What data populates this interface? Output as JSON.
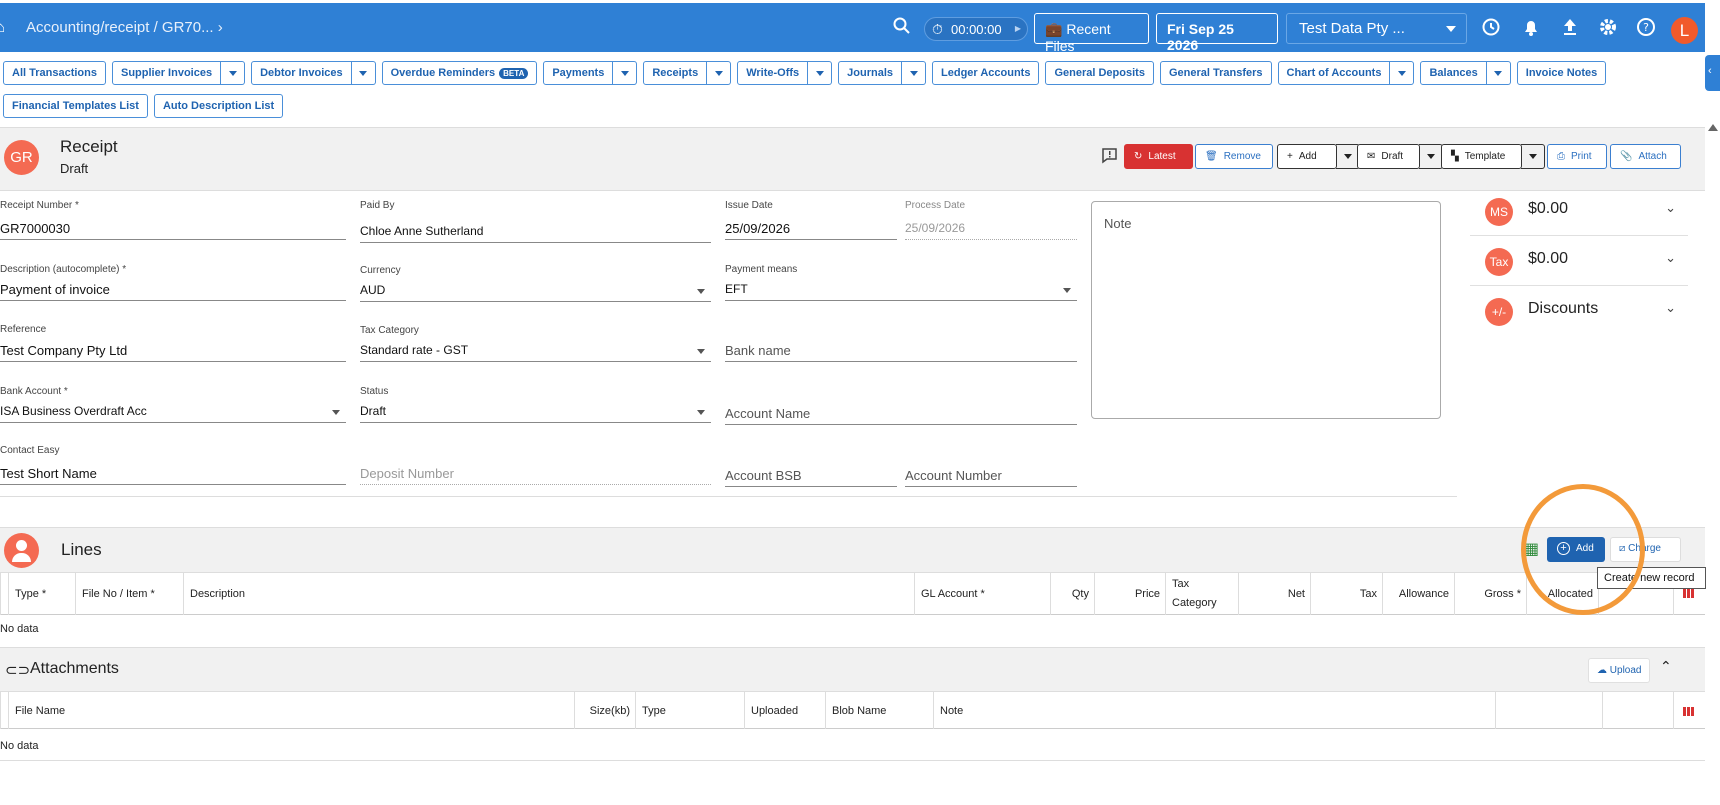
{
  "header": {
    "breadcrumb": "Accounting/receipt / GR70... ›",
    "timer": "00:00:00",
    "recent_files": "Recent Files",
    "date": "Fri Sep 25 2026",
    "company": "Test Data Pty ...",
    "avatar_letter": "L"
  },
  "nav": {
    "row1": [
      "All Transactions",
      "Supplier Invoices",
      "Debtor Invoices",
      "Overdue Reminders",
      "Payments",
      "Receipts",
      "Write-Offs",
      "Journals",
      "Ledger Accounts",
      "General Deposits",
      "General Transfers",
      "Chart of Accounts",
      "Balances",
      "Invoice Notes"
    ],
    "beta": "BETA",
    "row2": [
      "Financial Templates List",
      "Auto Description List"
    ]
  },
  "record": {
    "initials": "GR",
    "title": "Receipt",
    "status": "Draft",
    "actions": {
      "latest": "Latest",
      "remove": "Remove",
      "add": "Add",
      "draft": "Draft",
      "template": "Template",
      "print": "Print",
      "attach": "Attach"
    }
  },
  "form": {
    "receipt_number_label": "Receipt Number *",
    "receipt_number": "GR7000030",
    "paid_by_label": "Paid By",
    "paid_by": "Chloe Anne Sutherland",
    "issue_date_label": "Issue Date",
    "issue_date": "25/09/2026",
    "process_date_label": "Process Date",
    "process_date": "25/09/2026",
    "description_label": "Description (autocomplete) *",
    "description": "Payment of invoice",
    "currency_label": "Currency",
    "currency": "AUD",
    "payment_means_label": "Payment means",
    "payment_means": "EFT",
    "reference_label": "Reference",
    "reference": "Test Company Pty Ltd",
    "tax_category_label": "Tax Category",
    "tax_category": "Standard rate - GST",
    "bank_name_placeholder": "Bank name",
    "bank_account_label": "Bank Account *",
    "bank_account": "ISA Business Overdraft Acc",
    "status_label": "Status",
    "status": "Draft",
    "account_name_placeholder": "Account Name",
    "contact_label": "Contact Easy",
    "contact": "Test Short Name",
    "deposit_number_placeholder": "Deposit Number",
    "account_bsb_placeholder": "Account BSB",
    "account_number_placeholder": "Account Number",
    "note_placeholder": "Note"
  },
  "summary": {
    "ms_badge": "MS",
    "ms_value": "$0.00",
    "tax_badge": "Tax",
    "tax_value": "$0.00",
    "disc_badge": "+/-",
    "disc_label": "Discounts"
  },
  "lines": {
    "title": "Lines",
    "add": "Add",
    "charge": "Charge",
    "tooltip": "Create new record",
    "columns": [
      "Type *",
      "File No / Item *",
      "Description",
      "GL Account *",
      "Qty",
      "Price",
      "Tax Category",
      "Net",
      "Tax",
      "Allowance",
      "Gross *",
      "Allocated"
    ],
    "no_data": "No data"
  },
  "attachments": {
    "title": "Attachments",
    "upload": "Upload",
    "columns": [
      "File Name",
      "Size(kb)",
      "Type",
      "Uploaded",
      "Blob Name",
      "Note"
    ],
    "no_data": "No data"
  },
  "colors": {
    "primary": "#2f80d5",
    "accent": "#f46a52",
    "danger": "#d83232",
    "highlight": "#f39a3a"
  }
}
